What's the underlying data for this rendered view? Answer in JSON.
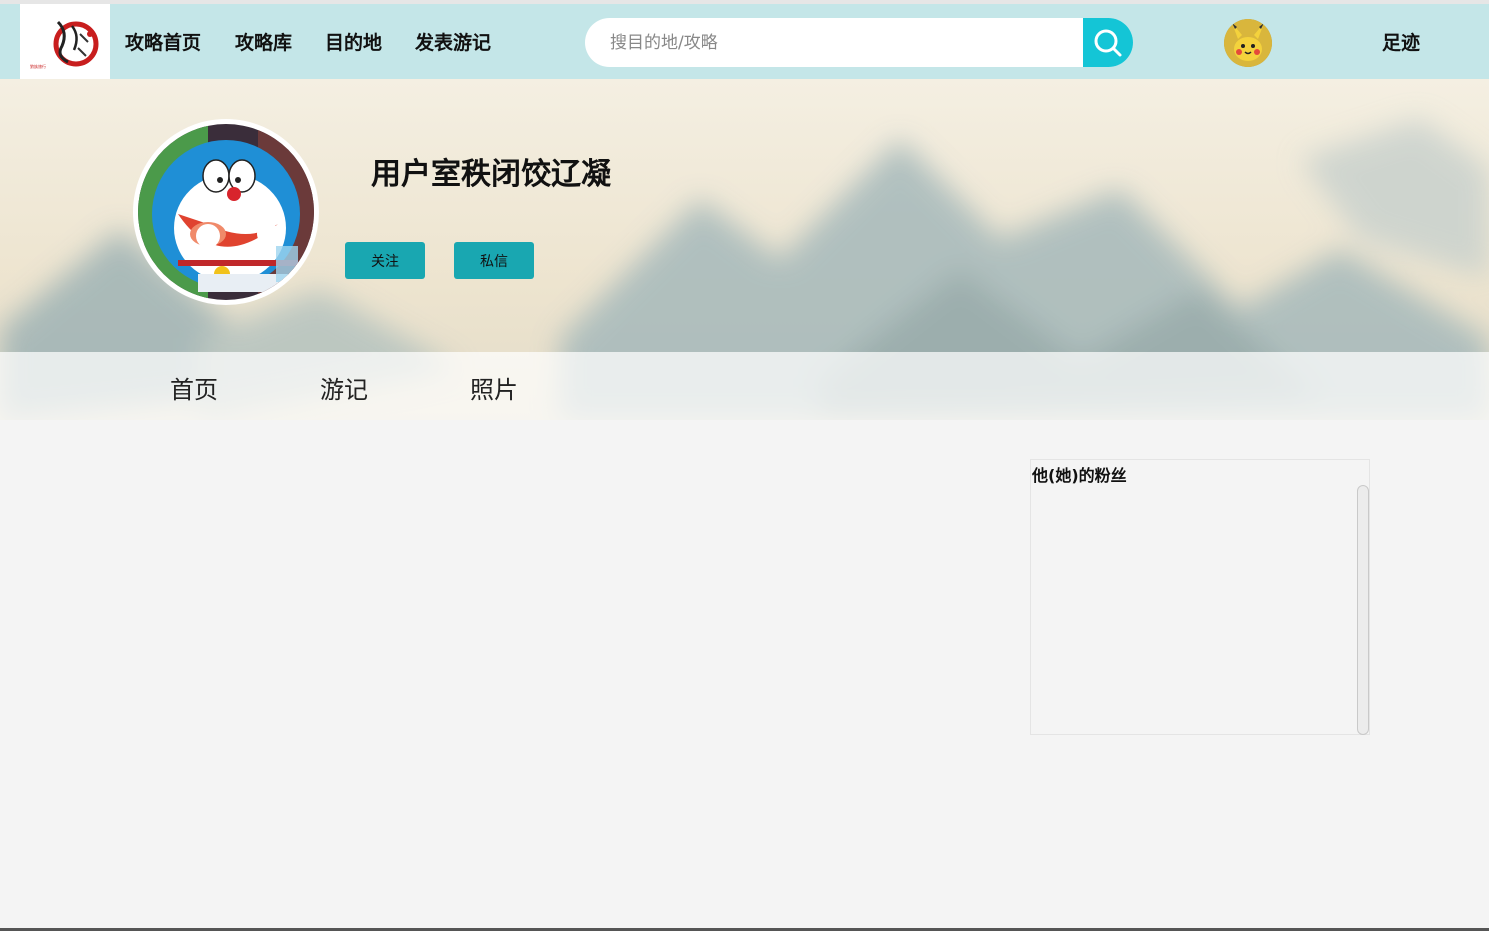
{
  "header": {
    "logo": {
      "icon": "brand-logo-icon",
      "text": "狼族旅行"
    },
    "nav": [
      "攻略首页",
      "攻略库",
      "目的地",
      "发表游记"
    ],
    "search": {
      "placeholder": "搜目的地/攻略",
      "value": "",
      "icon": "search-icon"
    },
    "avatar_icon": "user-avatar",
    "footprint_label": "足迹"
  },
  "profile": {
    "username": "用户室秩闭饺辽凝",
    "follow_label": "关注",
    "message_label": "私信",
    "avatar_icon": "doraemon-avatar"
  },
  "tabs": [
    "首页",
    "游记",
    "照片"
  ],
  "fans_panel": {
    "title": "他(她)的粉丝",
    "items": []
  },
  "colors": {
    "nav_bg": "#c4e6e8",
    "search_button": "#14c5d6",
    "action_button": "#19a7b1",
    "page_bg": "#f4f4f4"
  }
}
